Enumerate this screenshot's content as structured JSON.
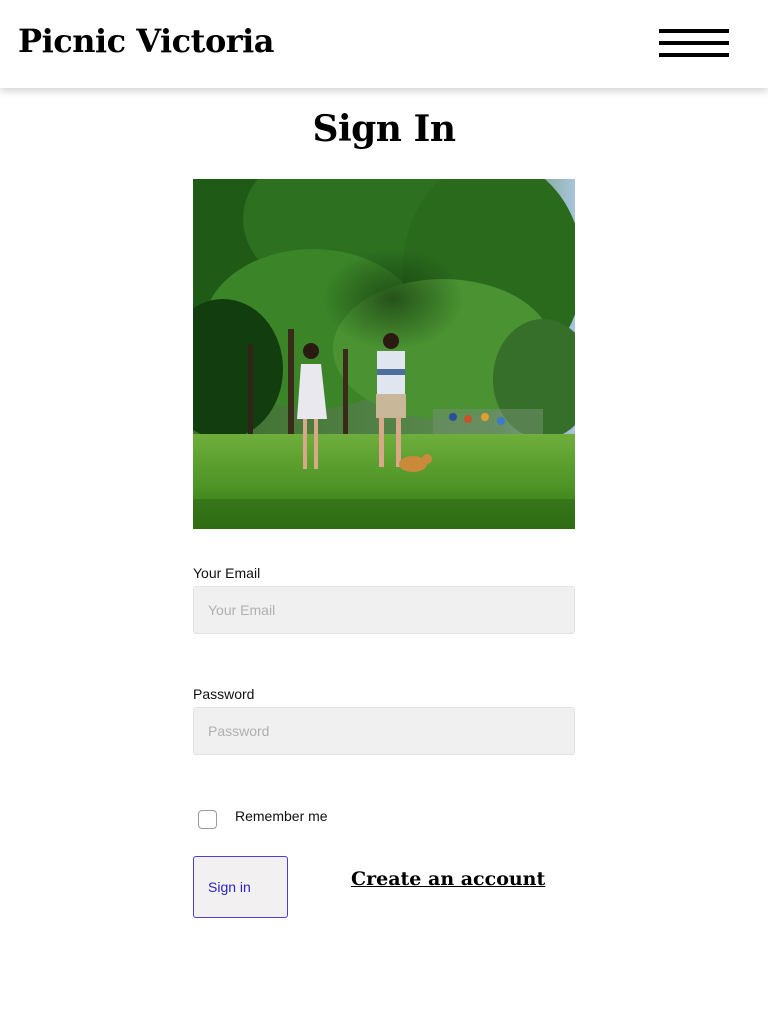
{
  "header": {
    "brand": "Picnic Victoria",
    "menu_icon": "hamburger-menu-icon"
  },
  "main": {
    "title": "Sign In",
    "hero_image": "photo-couple-walking-dog-in-park"
  },
  "form": {
    "email": {
      "label": "Your Email",
      "placeholder": "Your Email",
      "value": ""
    },
    "password": {
      "label": "Password",
      "placeholder": "Password",
      "value": ""
    },
    "remember": {
      "label": "Remember me",
      "checked": false
    },
    "submit_label": "Sign in",
    "create_account_label": "Create an account"
  },
  "colors": {
    "button_accent": "#2b22c8",
    "input_bg": "#f0f0f0"
  }
}
